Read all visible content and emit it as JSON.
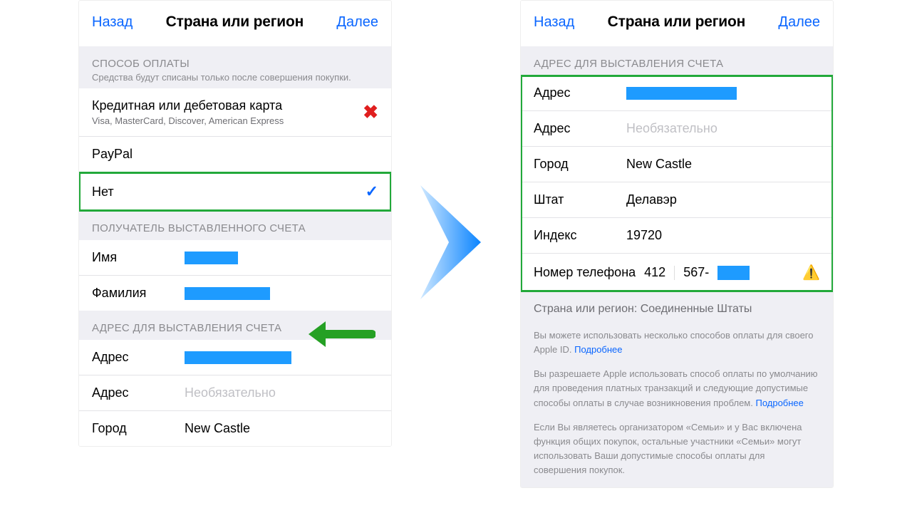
{
  "nav": {
    "back": "Назад",
    "title": "Страна или регион",
    "next": "Далее"
  },
  "left": {
    "paymentHeader": "СПОСОБ ОПЛАТЫ",
    "paymentSub": "Средства будут списаны только после совершения покупки.",
    "cardTitle": "Кредитная или дебетовая карта",
    "cardSub": "Visa, MasterCard, Discover, American Express",
    "paypal": "PayPal",
    "none": "Нет",
    "recipientHeader": "ПОЛУЧАТЕЛЬ ВЫСТАВЛЕННОГО СЧЕТА",
    "firstName": "Имя",
    "lastName": "Фамилия",
    "billingHeader": "АДРЕС ДЛЯ ВЫСТАВЛЕНИЯ СЧЕТА",
    "address": "Адрес",
    "optional": "Необязательно",
    "city": "Город",
    "cityVal": "New Castle"
  },
  "right": {
    "billingHeader": "АДРЕС ДЛЯ ВЫСТАВЛЕНИЯ СЧЕТА",
    "address": "Адрес",
    "optional": "Необязательно",
    "city": "Город",
    "cityVal": "New Castle",
    "state": "Штат",
    "stateVal": "Делавэр",
    "zip": "Индекс",
    "zipVal": "19720",
    "phoneLabel": "Номер телефона",
    "phoneArea": "412",
    "phonePart": "567-",
    "countryLine": "Страна или регион: Соединенные Штаты",
    "note1a": "Вы можете использовать несколько способов оплаты для своего Apple ID. ",
    "note2a": "Вы разрешаете Apple использовать способ оплаты по умолчанию для проведения платных транзакций и следующие допустимые способы оплаты в случае возникновения проблем. ",
    "note3": "Если Вы являетесь организатором «Семьи» и у Вас включена функция общих покупок, остальные участники «Семьи» могут использовать Ваши допустимые способы оплаты для совершения покупок.",
    "more": "Подробнее"
  }
}
